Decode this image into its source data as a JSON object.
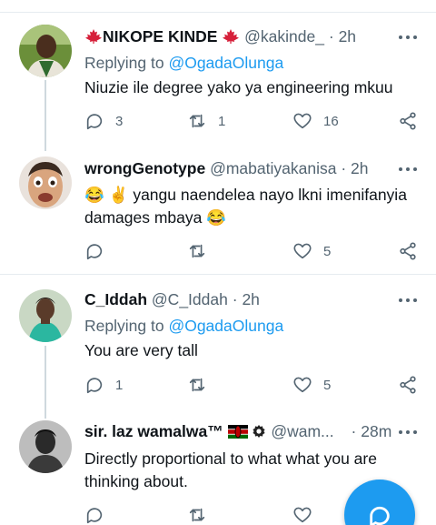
{
  "tweets": [
    {
      "name": "NIKOPE KINDE",
      "handle": "@kakinde_",
      "time": "2h",
      "replying_label": "Replying to",
      "replying_to": "@OgadaOlunga",
      "text": "Niuzie ile degree yako ya engineering mkuu",
      "replies": "3",
      "retweets": "1",
      "likes": "16"
    },
    {
      "name": "wrongGenotype",
      "handle": "@mabatiyakanisa",
      "time": "2h",
      "emoji_prefix": "😂 ✌️",
      "text_line1": "yangu naendelea nayo lkni imenifanyia",
      "text_line2": "damages mbaya",
      "emoji_suffix": "😂",
      "replies": "",
      "retweets": "",
      "likes": "5"
    },
    {
      "name": "C_Iddah",
      "handle": "@C_Iddah",
      "time": "2h",
      "replying_label": "Replying to",
      "replying_to": "@OgadaOlunga",
      "text": "You are very tall",
      "replies": "1",
      "retweets": "",
      "likes": "5"
    },
    {
      "name": "sir. laz wamalwa™",
      "handle": "@wam...",
      "time": "28m",
      "text": "Directly proportional to what what you are thinking about.",
      "replies": "",
      "retweets": "",
      "likes": ""
    }
  ],
  "separator": "·",
  "colors": {
    "accent": "#1d9bf0",
    "secondary_text": "#536471",
    "divider": "#e6ecf0",
    "thread_line": "#cfd9de",
    "maple_leaf": "#d6203a"
  },
  "icons": {
    "reply": "reply-icon",
    "retweet": "retweet-icon",
    "like": "heart-icon",
    "share": "share-icon",
    "more": "more-dots-icon",
    "compose": "compose-icon"
  }
}
